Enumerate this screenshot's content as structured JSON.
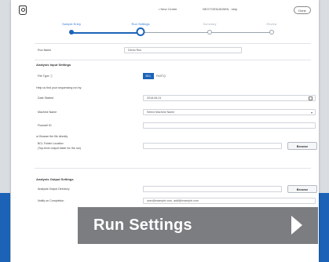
{
  "header": {
    "link1": "• New Center",
    "link2": "NEXTGEN/ADMIN . help",
    "pill": "Done"
  },
  "steps": [
    {
      "label": "Sample Entry",
      "state": "done"
    },
    {
      "label": "Run Settings",
      "state": "current"
    },
    {
      "label": "Summary",
      "state": "future"
    },
    {
      "label": "Review",
      "state": "future"
    }
  ],
  "form": {
    "run_name_label": "Run Name",
    "run_name_value": "Demo Run",
    "input_section": "Analysis Input Settings",
    "file_type_label": "File Type ⓘ",
    "file_type_options": [
      "BCL",
      "FASTQ"
    ],
    "help_text": "Help us find your sequencing run by:",
    "date_label": "Date Started",
    "date_value": "2018-06-01",
    "machine_label": "Machine Name",
    "machine_value": "Select Machine Name",
    "flowcell_label": "Flowcell ID",
    "or_text": "or Browse the file directly",
    "bcl_label": "BCL Folder Location",
    "bcl_help": "(Top-level output folder for the run)",
    "browse_label": "Browse",
    "output_section": "Analysis Output Settings",
    "output_dir_label": "Analysis Output Directory",
    "browse_label_2": "Browse",
    "notify_label": "Notify on Completion",
    "notify_value": "user@example.com, addl@example.com"
  },
  "banner": {
    "title": "Run Settings"
  },
  "colors": {
    "accent": "#1c63b8",
    "banner": "#7b7d80"
  }
}
